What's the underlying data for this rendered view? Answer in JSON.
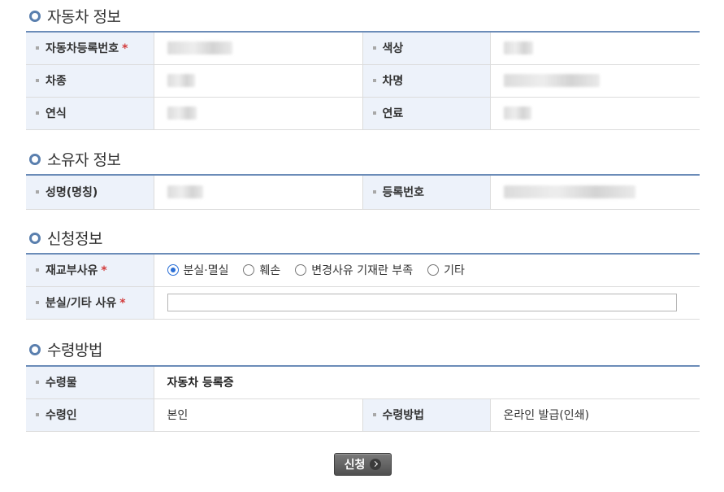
{
  "sections": {
    "vehicle": {
      "title": "자동차 정보",
      "reg_no_label": "자동차등록번호",
      "required_mark": "*",
      "color_label": "색상",
      "type_label": "차종",
      "name_label": "차명",
      "year_label": "연식",
      "fuel_label": "연료"
    },
    "owner": {
      "title": "소유자 정보",
      "name_label": "성명(명칭)",
      "reg_no_label": "등록번호"
    },
    "application": {
      "title": "신청정보",
      "reason_label": "재교부사유",
      "required_mark": "*",
      "reason_options": [
        "분실·멸실",
        "훼손",
        "변경사유 기재란 부족",
        "기타"
      ],
      "selected_reason": "분실·멸실",
      "detail_label": "분실/기타 사유",
      "detail_value": "",
      "detail_placeholder": ""
    },
    "receipt": {
      "title": "수령방법",
      "item_label": "수령물",
      "item_value": "자동차 등록증",
      "receiver_label": "수령인",
      "receiver_value": "본인",
      "method_label": "수령방법",
      "method_value": "온라인 발급(인쇄)"
    }
  },
  "submit_label": "신청",
  "colors": {
    "header_bg": "#edf2fa",
    "table_top_border": "#6b8cb8",
    "bullet": "#5a7fae",
    "required": "#d23b3b",
    "button": "#606060"
  },
  "icons": {
    "section_bullet": "circle-bullet-icon",
    "label_dot": "square-dot-icon",
    "submit_arrow": "chevron-right-icon"
  }
}
